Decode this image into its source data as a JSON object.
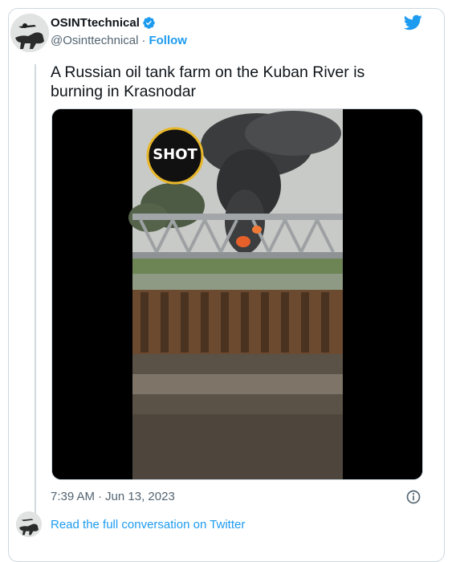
{
  "account": {
    "display_name": "OSINTtechnical",
    "handle": "@Osinttechnical",
    "separator": "·",
    "follow_label": "Follow"
  },
  "tweet": {
    "text": "A Russian oil tank farm on the Kuban River is burning in Krasnodar",
    "media_watermark": "SHOT",
    "time": "7:39 AM",
    "separator": "·",
    "date": "Jun 13, 2023"
  },
  "footer": {
    "read_more_label": "Read the full conversation on Twitter"
  },
  "colors": {
    "link": "#1d9bf0",
    "text": "#0f1419",
    "secondary": "#536471",
    "border": "#cfd9de"
  },
  "icons": [
    "verified-badge-icon",
    "twitter-bird-icon",
    "info-icon"
  ]
}
